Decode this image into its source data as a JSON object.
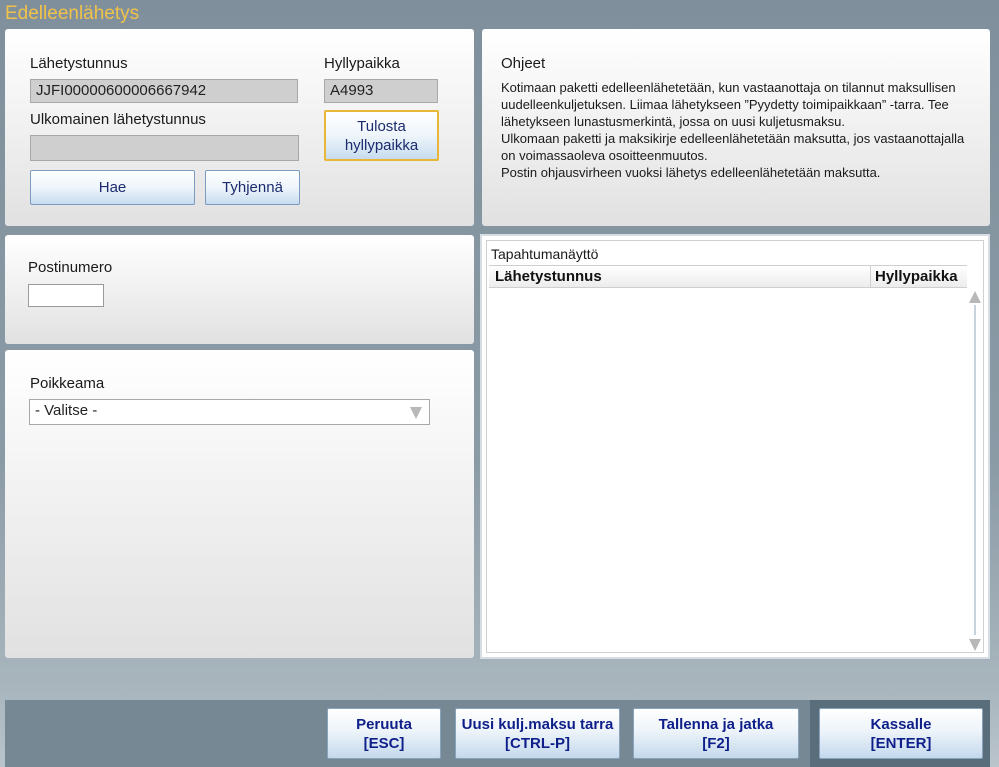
{
  "app": {
    "title": "Edelleenlähetys"
  },
  "shipment": {
    "tracking_label": "Lähetystunnus",
    "tracking_value": "JJFI00000600006667942",
    "shelf_label": "Hyllypaikka",
    "shelf_value": "A4993",
    "print_shelf_button": "Tulosta hyllypaikka",
    "foreign_tracking_label": "Ulkomainen lähetystunnus",
    "foreign_tracking_value": "",
    "search_button": "Hae",
    "clear_button": "Tyhjennä"
  },
  "instructions": {
    "title": "Ohjeet",
    "paragraphs": [
      "Kotimaan paketti edelleenlähetetään, kun vastaanottaja on tilannut maksullisen uudelleenkuljetuksen. Liimaa lähetykseen ”Pyydetty toimipaikkaan” -tarra. Tee lähetykseen lunastusmerkintä, jossa on uusi kuljetusmaksu.",
      "Ulkomaan paketti ja maksikirje edelleenlähetetään maksutta, jos vastaanottajalla on voimassaoleva osoitteenmuutos.",
      "Postin ohjausvirheen vuoksi lähetys edelleenlähetetään maksutta."
    ]
  },
  "postal": {
    "label": "Postinumero",
    "value": ""
  },
  "deviation": {
    "label": "Poikkeama",
    "selected": "- Valitse -"
  },
  "events": {
    "title": "Tapahtumanäyttö",
    "columns": [
      "Lähetystunnus",
      "Hyllypaikka"
    ],
    "rows": []
  },
  "footer": {
    "cancel": {
      "label": "Peruuta",
      "shortcut": "[ESC]"
    },
    "new_fee_label": {
      "label": "Uusi kulj.maksu tarra",
      "shortcut": "[CTRL-P]"
    },
    "save_continue": {
      "label": "Tallenna ja jatka",
      "shortcut": "[F2]"
    },
    "checkout": {
      "label": "Kassalle",
      "shortcut": "[ENTER]"
    }
  },
  "colors": {
    "title": "#f1c24a",
    "button_text": "#1b2b6e",
    "footer_button_text": "#0f1f8a",
    "focus_border": "#e8b738"
  }
}
